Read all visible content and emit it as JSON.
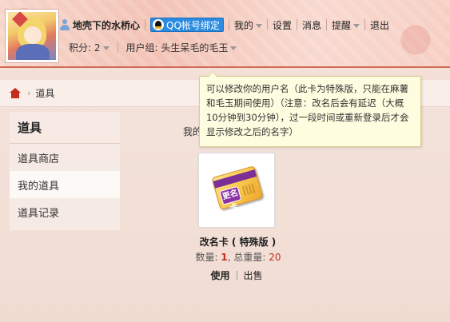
{
  "header": {
    "username": "地壳下的水桥心",
    "qq_bind_label": "QQ帐号绑定",
    "nav": {
      "mine": "我的",
      "settings": "设置",
      "messages": "消息",
      "reminders": "提醒",
      "logout": "退出"
    },
    "points": "积分: 2",
    "usergroup": "用户组: 头生呆毛的毛玉"
  },
  "breadcrumb": {
    "current": "道具"
  },
  "sidebar": {
    "title": "道具",
    "items": [
      {
        "label": "道具商店",
        "active": false
      },
      {
        "label": "我的道具",
        "active": true
      },
      {
        "label": "道具记录",
        "active": false
      }
    ]
  },
  "main": {
    "label": "我的",
    "item": {
      "card_badge": "更名卡",
      "name": "改名卡 ( 特殊版 )",
      "qty_prefix": "数量: ",
      "qty": "1",
      "total_prefix": ", 总重量: ",
      "total_weight": "20",
      "use_label": "使用",
      "sell_label": "出售"
    }
  },
  "tooltip": {
    "text": "可以修改你的用户名（此卡为特殊版，只能在麻薯和毛玉期间使用）（注意：改名后会有延迟（大概10分钟到30分钟），过一段时间或重新登录后才会显示修改之后的名字）"
  }
}
